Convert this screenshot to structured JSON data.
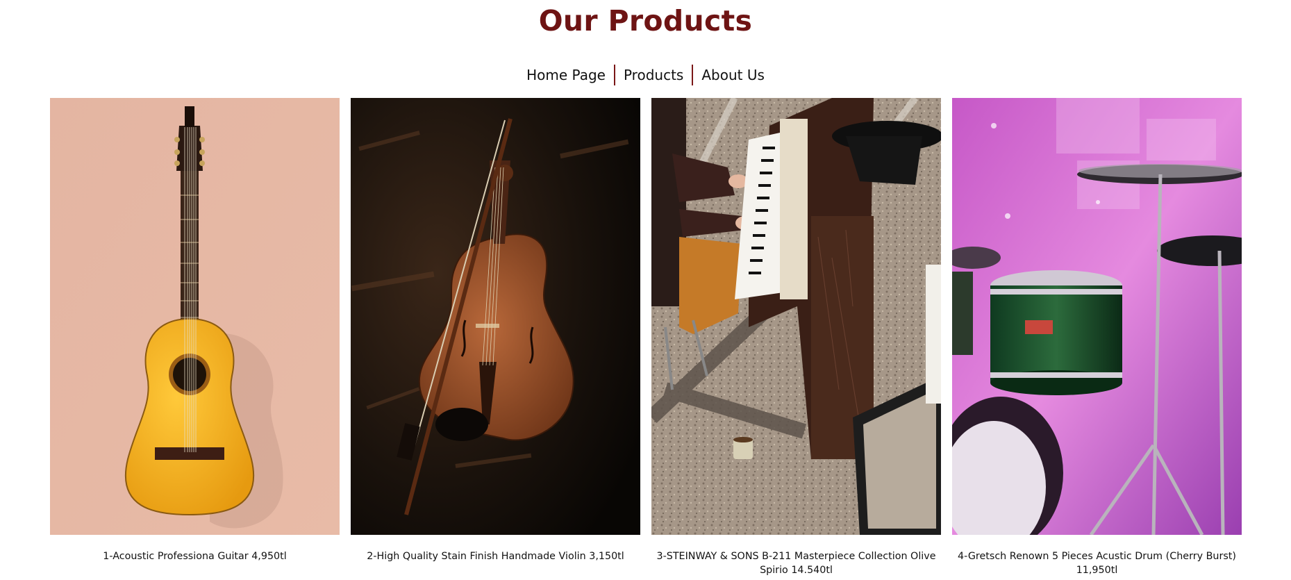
{
  "page": {
    "title": "Our Products",
    "title_color": "#6e1414"
  },
  "nav": {
    "items": [
      {
        "label": "Home Page"
      },
      {
        "label": "Products"
      },
      {
        "label": "About Us"
      }
    ],
    "separator_color": "#7a1717"
  },
  "products": [
    {
      "caption": "1-Acoustic Professiona Guitar 4,950tl",
      "image": "acoustic-guitar-photo"
    },
    {
      "caption": "2-High Quality Stain Finish Handmade Violin 3,150tl",
      "image": "violin-photo"
    },
    {
      "caption": "3-STEINWAY & SONS B-211 Masterpiece Collection Olive Spirio 14.540tl",
      "image": "piano-photo"
    },
    {
      "caption": "4-Gretsch Renown 5 Pieces Acustic Drum (Cherry Burst) 11,950tl",
      "image": "drum-kit-photo"
    }
  ]
}
